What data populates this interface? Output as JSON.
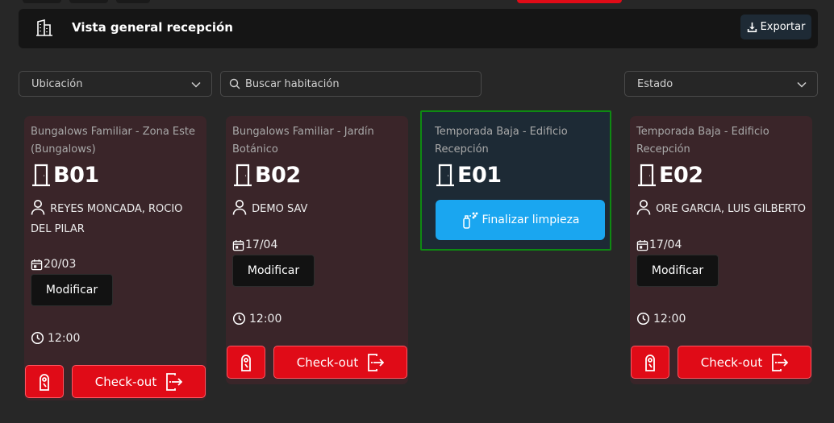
{
  "header": {
    "title": "Vista general recepción",
    "export_label": "Exportar",
    "icon": "building-icon"
  },
  "filters": {
    "location_label": "Ubicación",
    "search_placeholder": "Buscar habitación",
    "state_label": "Estado"
  },
  "cards": [
    {
      "location": "Bungalows Familiar - Zona Este (Bungalows)",
      "room": "B01",
      "guest": "REYES MONCADA, ROCIO DEL PILAR",
      "date": "20/03",
      "modify_label": "Modificar",
      "time": "12:00",
      "checkout_label": "Check-out"
    },
    {
      "location": "Bungalows Familiar - Jardín Botánico",
      "room": "B02",
      "guest": "DEMO SAV",
      "date": "17/04",
      "modify_label": "Modificar",
      "time": "12:00",
      "checkout_label": "Check-out"
    },
    {
      "location": "Temporada Baja - Edificio Recepción",
      "room": "E01",
      "action_label": "Finalizar limpieza"
    },
    {
      "location": "Temporada Baja - Edificio Recepción",
      "room": "E02",
      "guest": "ORE GARCIA, LUIS GILBERTO",
      "date": "17/04",
      "modify_label": "Modificar",
      "time": "12:00",
      "checkout_label": "Check-out"
    }
  ],
  "colors": {
    "background": "#272727",
    "card_occupied": "#3a2529",
    "card_cleaning": "#1d2a35",
    "cleaning_border": "#0e8a12",
    "accent_red": "#e00b17",
    "accent_blue": "#1aa6f0"
  }
}
